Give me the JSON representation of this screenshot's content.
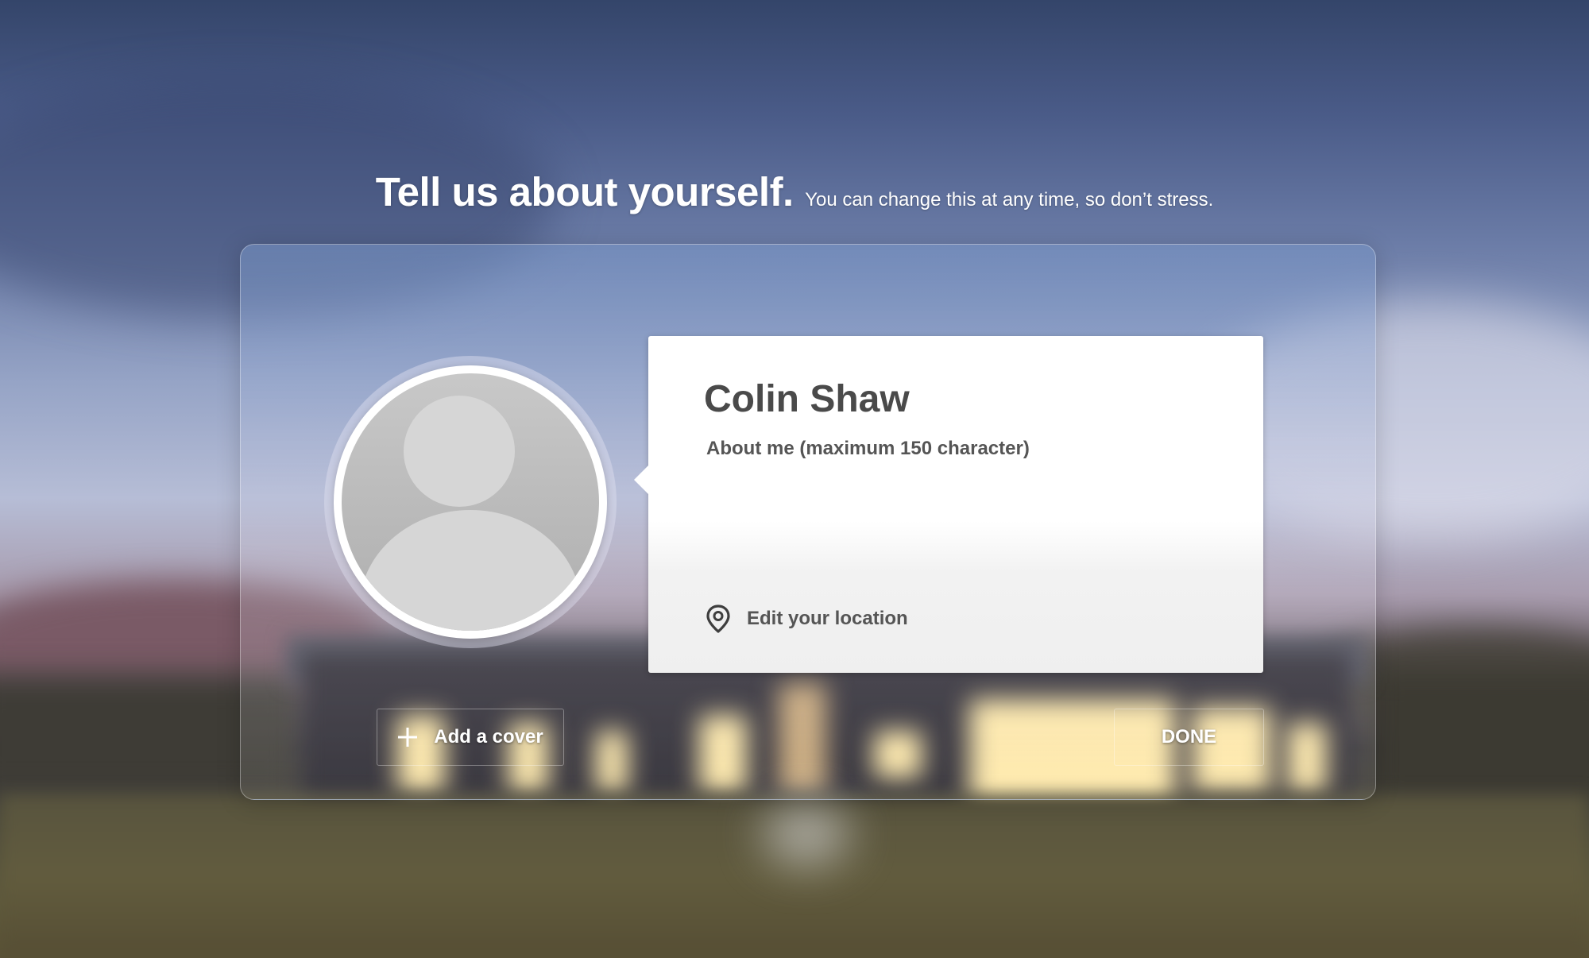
{
  "heading": {
    "title": "Tell us about yourself.",
    "subtitle": "You can change this at any time, so don’t stress."
  },
  "profile": {
    "name": "Colin Shaw",
    "about_placeholder": "About me (maximum 150 character)",
    "location_label": "Edit your location",
    "location_icon": "map-pin-icon",
    "avatar_icon": "user-silhouette-icon"
  },
  "actions": {
    "add_cover_label": "Add a cover",
    "add_cover_icon": "plus-icon",
    "done_label": "DONE"
  }
}
